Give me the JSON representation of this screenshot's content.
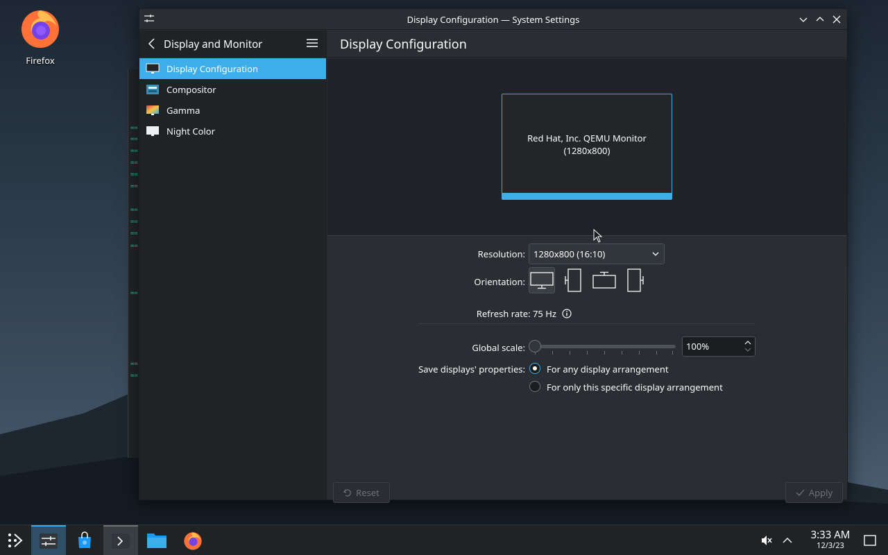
{
  "desktop": {
    "icons": [
      {
        "label": "Firefox",
        "icon": "firefox-icon"
      }
    ]
  },
  "window": {
    "title": "Display Configuration — System Settings",
    "controls": [
      "minimize",
      "maximize",
      "close"
    ]
  },
  "sidebar": {
    "title": "Display and Monitor",
    "items": [
      {
        "label": "Display Configuration",
        "icon": "monitor-icon",
        "active": true
      },
      {
        "label": "Compositor",
        "icon": "compositor-icon",
        "active": false
      },
      {
        "label": "Gamma",
        "icon": "gamma-icon",
        "active": false
      },
      {
        "label": "Night Color",
        "icon": "night-color-icon",
        "active": false
      }
    ]
  },
  "main": {
    "title": "Display Configuration",
    "monitor": {
      "name": "Red Hat, Inc. QEMU Monitor",
      "resolution_text": "(1280x800)"
    },
    "resolution": {
      "label": "Resolution:",
      "value": "1280x800 (16:10)"
    },
    "orientation": {
      "label": "Orientation:",
      "selected": 0
    },
    "refresh": {
      "text": "Refresh rate: 75 Hz"
    },
    "global_scale": {
      "label": "Global scale:",
      "value": "100%",
      "level": 0
    },
    "save_props": {
      "label": "Save displays' properties:",
      "options": [
        {
          "label": "For any display arrangement",
          "selected": true
        },
        {
          "label": "For only this specific display arrangement",
          "selected": false
        }
      ]
    },
    "buttons": {
      "reset": "Reset",
      "apply": "Apply"
    }
  },
  "taskbar": {
    "time": "3:33 AM",
    "date": "12/3/23"
  },
  "colors": {
    "accent": "#3daee9",
    "window_bg": "#2a2e32",
    "sidebar_bg": "#202326"
  }
}
